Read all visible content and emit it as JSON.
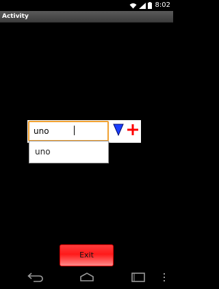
{
  "status_bar": {
    "time": "8:02",
    "icons": [
      "wifi-icon",
      "signal-icon",
      "battery-icon"
    ]
  },
  "action_bar": {
    "title": "Activity"
  },
  "combo": {
    "input_value": "uno",
    "dropdown_icon": "triangle-down-icon",
    "add_icon": "plus-icon",
    "dropdown_color": "#1a3fff",
    "add_color": "#ff0000",
    "focus_color": "#f0a030"
  },
  "suggestions": {
    "items": [
      {
        "label": "uno"
      }
    ]
  },
  "exit_button": {
    "label": "Exit",
    "color": "#ff1a1a"
  },
  "navigation": {
    "icons": [
      "back-icon",
      "home-icon",
      "recents-icon",
      "menu-icon"
    ]
  }
}
